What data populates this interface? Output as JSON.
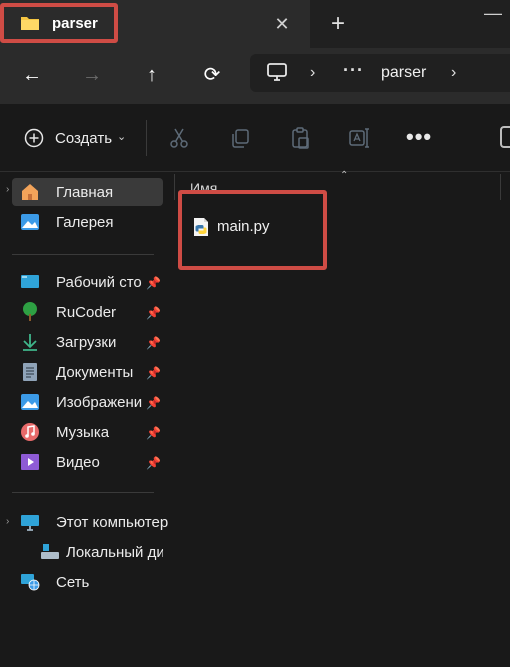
{
  "tab": {
    "title": "parser",
    "close_glyph": "✕",
    "new_tab_glyph": "+"
  },
  "window": {
    "minimize_glyph": "—"
  },
  "nav": {
    "back_glyph": "←",
    "forward_glyph": "→",
    "up_glyph": "↑",
    "refresh_glyph": "⟳",
    "breadcrumb_sep": "›",
    "breadcrumb_more": "···",
    "breadcrumb_folder": "parser"
  },
  "commands": {
    "create_label": "Создать",
    "create_chevron": "⌄",
    "more_glyph": "•••"
  },
  "sidebar": {
    "items": [
      {
        "label": "Главная",
        "icon": "home-icon",
        "pinned": false
      },
      {
        "label": "Галерея",
        "icon": "gallery-icon",
        "pinned": false
      },
      {
        "label": "Рабочий сто",
        "icon": "desktop-icon",
        "pinned": true
      },
      {
        "label": "RuCoder",
        "icon": "tree-folder-icon",
        "pinned": true
      },
      {
        "label": "Загрузки",
        "icon": "download-icon",
        "pinned": true
      },
      {
        "label": "Документы",
        "icon": "documents-icon",
        "pinned": true
      },
      {
        "label": "Изображени",
        "icon": "pictures-icon",
        "pinned": true
      },
      {
        "label": "Музыка",
        "icon": "music-icon",
        "pinned": true
      },
      {
        "label": "Видео",
        "icon": "video-icon",
        "pinned": true
      },
      {
        "label": "Этот компьютер",
        "icon": "computer-icon",
        "pinned": false
      },
      {
        "label": "Локальный ди",
        "icon": "local-disk-icon",
        "pinned": false
      },
      {
        "label": "Сеть",
        "icon": "network-icon",
        "pinned": false
      }
    ],
    "pin_glyph": "📌",
    "expand_glyph": "›"
  },
  "content": {
    "column_header": "Имя",
    "sort_glyph": "⌃",
    "files": [
      {
        "name": "main.py",
        "icon": "python-file-icon"
      }
    ]
  },
  "colors": {
    "accent_highlight": "#cf4c45",
    "folder": "#f4c542",
    "background": "#191919"
  }
}
